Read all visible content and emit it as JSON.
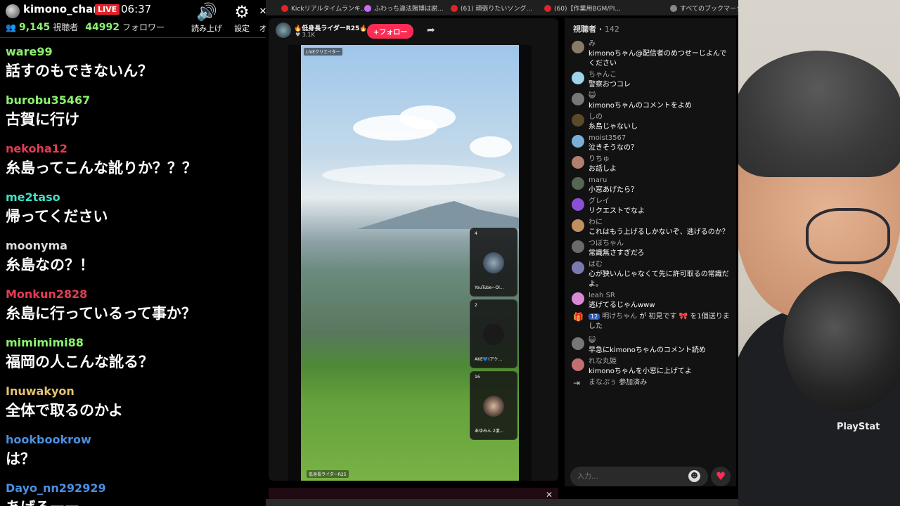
{
  "overlay": {
    "channel": "kimono_chan",
    "live_badge": "LIVE",
    "clock": "06:37",
    "viewers_count": "9,145",
    "viewers_label": "視聴者",
    "followers_count": "44992",
    "followers_label": "フォロワー",
    "read_aloud_label": "読み上げ",
    "settings_label": "設定",
    "extra_label": "オ"
  },
  "chat": [
    {
      "user": "ware99",
      "color": "#8cf26e",
      "text": "話すのもできないん？"
    },
    {
      "user": "burobu35467",
      "color": "#8cf26e",
      "text": "古賀に行け"
    },
    {
      "user": "nekoha12",
      "color": "#e43c55",
      "text": "糸島ってこんな訛りか？？？"
    },
    {
      "user": "me2taso",
      "color": "#3ee0c8",
      "text": "帰ってください"
    },
    {
      "user": "moonyma",
      "color": "#dddddd",
      "text": "糸島なの？！"
    },
    {
      "user": "Monkun2828",
      "color": "#e43c55",
      "text": "糸島に行っているって事か？"
    },
    {
      "user": "mimimimi88",
      "color": "#8cf26e",
      "text": "福岡の人こんな訛る？"
    },
    {
      "user": "Inuwakyon",
      "color": "#e3c370",
      "text": "全体で取るのかよ"
    },
    {
      "user": "hookbookrow",
      "color": "#4a90e2",
      "text": "は？"
    },
    {
      "user": "Dayo_nn292929",
      "color": "#4a90e2",
      "text": "あげろーー"
    }
  ],
  "bookmarks": [
    {
      "label": "Kickリアルタイムランキ...",
      "color": "#e0242a"
    },
    {
      "label": "ふわっち違法賭博は謝...",
      "color": "#c76bff"
    },
    {
      "label": "(61) 頑張りたいソング...",
      "color": "#e0242a"
    },
    {
      "label": "(60)【作業用BGM/PI...",
      "color": "#e0242a"
    },
    {
      "label": "すべてのブックマーク",
      "color": "#888888"
    }
  ],
  "stream": {
    "streamer_name": "🔥低身長ライダーR25🔥",
    "likes": "♥ 3.1K",
    "follow_label": "+フォロー",
    "live_creator_tag": "LIVEクリエイター",
    "bottom_label": "低身長ライダーR25",
    "cards": [
      {
        "count": "4",
        "name": "YouTube~Ol..."
      },
      {
        "count": "2",
        "name": "AKE💙(アケ..."
      },
      {
        "count": "16",
        "name": "あゆみん 2度..."
      }
    ]
  },
  "viewers_panel": {
    "title": "視聴者",
    "count": "142",
    "comments": [
      {
        "name": "み",
        "text": "kimonoちゃん@配信者のめつせーじよんでください",
        "avatar": "#8a7a6a"
      },
      {
        "name": "ちゃんこ",
        "text": "警察おつコレ",
        "avatar": "#9fd4e8"
      },
      {
        "name": "😺",
        "text": "kimonoちゃんのコメントをよめ",
        "avatar": "#777777"
      },
      {
        "name": "しの",
        "text": "糸島じゃないし",
        "avatar": "#5a4a2a"
      },
      {
        "name": "moist3567",
        "text": "泣きそうなの？",
        "avatar": "#7ab0d8"
      },
      {
        "name": "りちゅ",
        "text": "お話しよ",
        "avatar": "#b08070"
      },
      {
        "name": "maru",
        "text": "小窓あげたら？",
        "avatar": "#556655"
      },
      {
        "name": "グレイ",
        "text": "リクエストでなよ",
        "avatar": "#8a4fd6"
      },
      {
        "name": "わに",
        "text": "これはもう上げるしかないぞ、逃げるのか？",
        "avatar": "#c09060"
      },
      {
        "name": "つぼちゃん",
        "text": "常識無さすぎだろ",
        "avatar": "#6a6a6a"
      },
      {
        "name": "はむ",
        "text": "心が狭いんじゃなくて先に許可取るの常識だよ。",
        "avatar": "#7a7ab0"
      },
      {
        "name": "leah SR",
        "text": "逃げてるじゃんwww",
        "avatar": "#d68ad6"
      }
    ],
    "gift": {
      "level": "12",
      "user": "明けちゃん",
      "text": "が 初見です 🎀 を1個送りました"
    },
    "comments2": [
      {
        "name": "😺",
        "text": "早急にkimonoちゃんのコメント読め",
        "avatar": "#777777"
      },
      {
        "name": "れな丸姫",
        "text": "kimonoちゃんを小窓に上げてよ",
        "avatar": "#c07070"
      }
    ],
    "joined": {
      "user": "まなぷぅ",
      "text": "参加済み"
    },
    "input_placeholder": "入力..."
  },
  "webcam": {
    "shirt_text": "PlayStat"
  }
}
